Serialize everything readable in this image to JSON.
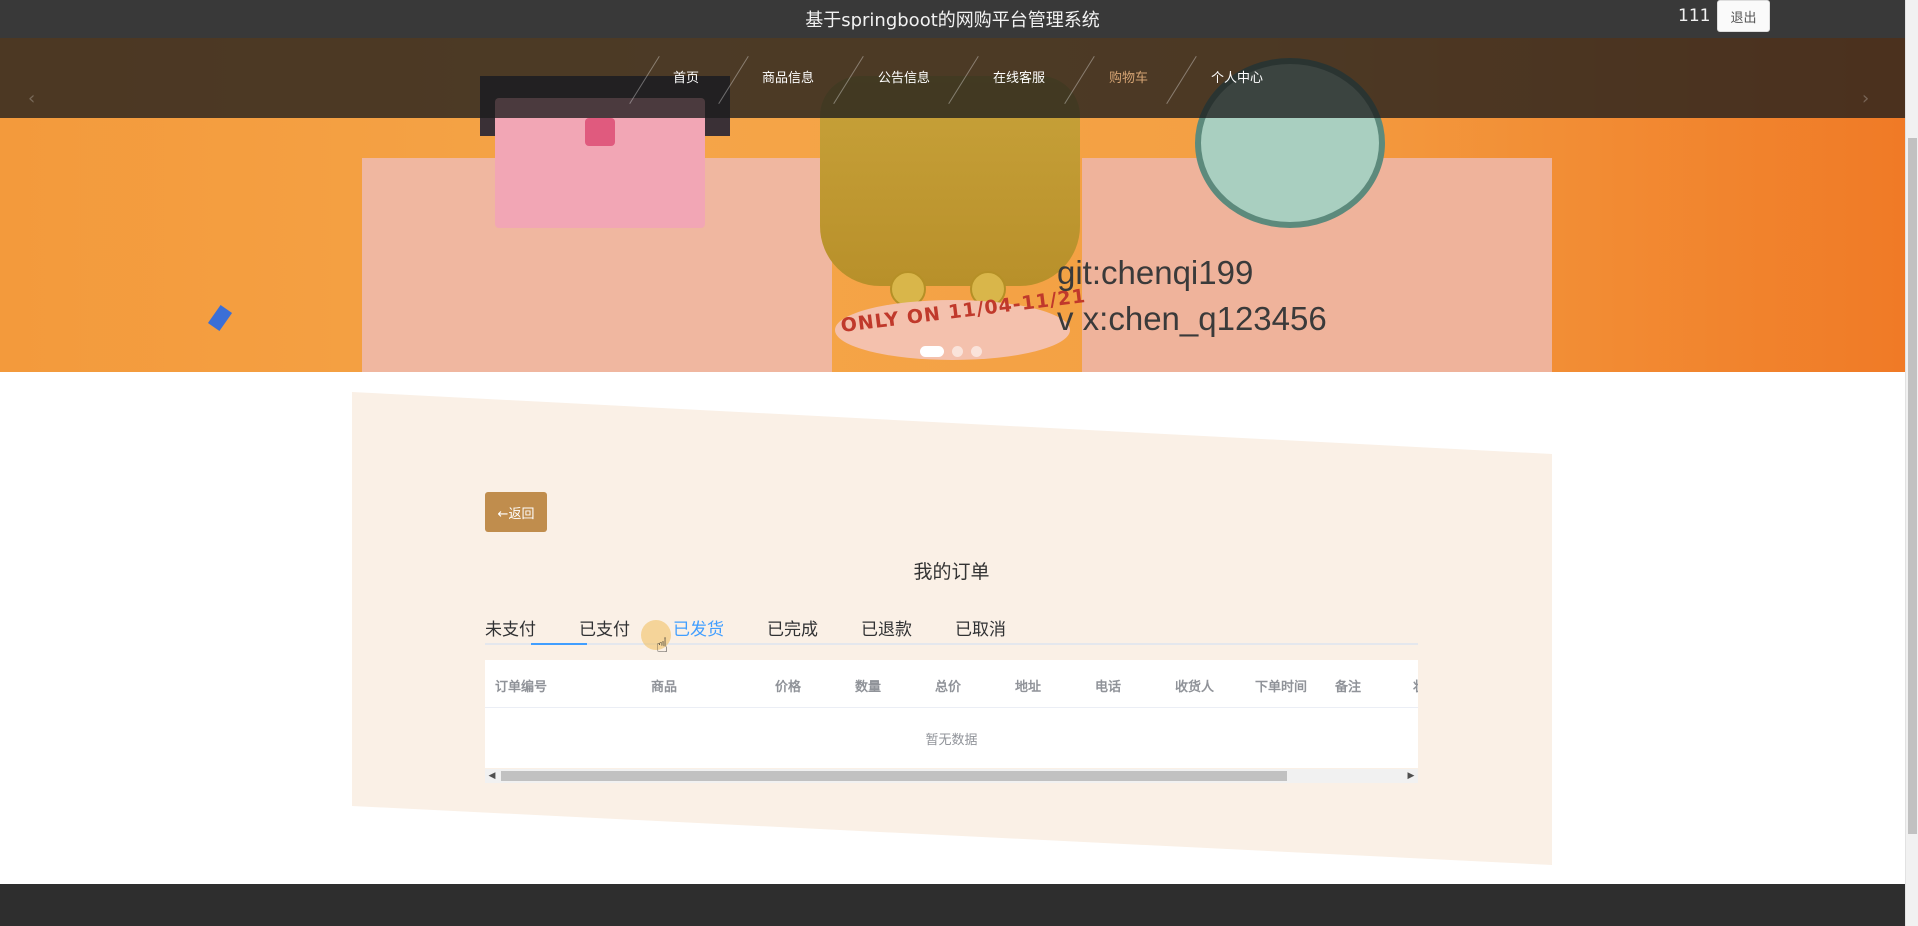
{
  "header": {
    "site_title": "基于springboot的网购平台管理系统",
    "username": "111",
    "logout_label": "退出"
  },
  "nav": {
    "items": [
      {
        "label": "首页"
      },
      {
        "label": "商品信息"
      },
      {
        "label": "公告信息"
      },
      {
        "label": "在线客服"
      },
      {
        "label": "购物车"
      },
      {
        "label": "个人中心"
      }
    ],
    "active_index": 4,
    "active_color": "#d4a373"
  },
  "banner": {
    "promo_text": "ONLY ON 11/04-11/21",
    "watermark_line1": "git:chenqi199",
    "watermark_line2": "v x:chen_q123456",
    "slide_count": 3,
    "active_slide": 0
  },
  "orders": {
    "back_label": "←返回",
    "title": "我的订单",
    "tabs": [
      {
        "label": "未支付"
      },
      {
        "label": "已支付"
      },
      {
        "label": "已发货"
      },
      {
        "label": "已完成"
      },
      {
        "label": "已退款"
      },
      {
        "label": "已取消"
      }
    ],
    "active_tab_index": 1,
    "hover_tab_index": 2,
    "accent_color": "#409eff",
    "columns": [
      {
        "label": "订单编号"
      },
      {
        "label": "商品"
      },
      {
        "label": "价格"
      },
      {
        "label": "数量"
      },
      {
        "label": "总价"
      },
      {
        "label": "地址"
      },
      {
        "label": "电话"
      },
      {
        "label": "收货人"
      },
      {
        "label": "下单时间"
      },
      {
        "label": "备注"
      },
      {
        "label": "状"
      }
    ],
    "empty_text": "暂无数据"
  },
  "colors": {
    "topbar": "#393939",
    "back_button": "#c08d4d",
    "panel_bg": "#faf0e6",
    "footer": "#2e2e2e"
  }
}
